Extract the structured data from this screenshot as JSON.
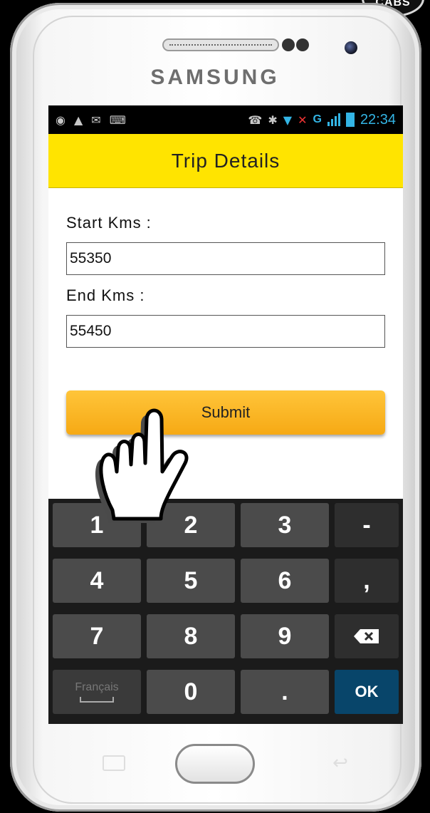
{
  "badge": {
    "text": "CABS"
  },
  "device": {
    "brand": "SAMSUNG"
  },
  "status_bar": {
    "network": "G",
    "time": "22:34"
  },
  "header": {
    "title": "Trip Details",
    "color": "#ffe400"
  },
  "form": {
    "start_label": "Start Kms :",
    "start_value": "55350",
    "end_label": "End Kms :",
    "end_value": "55450",
    "submit_label": "Submit"
  },
  "keyboard": {
    "keys": {
      "k1": "1",
      "k2": "2",
      "k3": "3",
      "dash": "-",
      "k4": "4",
      "k5": "5",
      "k6": "6",
      "comma": ",",
      "k7": "7",
      "k8": "8",
      "k9": "9",
      "lang": "Français",
      "k0": "0",
      "dot": ".",
      "ok": "OK"
    },
    "backspace_icon": "backspace-icon",
    "ok_color": "#08456a"
  },
  "colors": {
    "accent": "#33b5e5",
    "button": "#f6a914"
  }
}
